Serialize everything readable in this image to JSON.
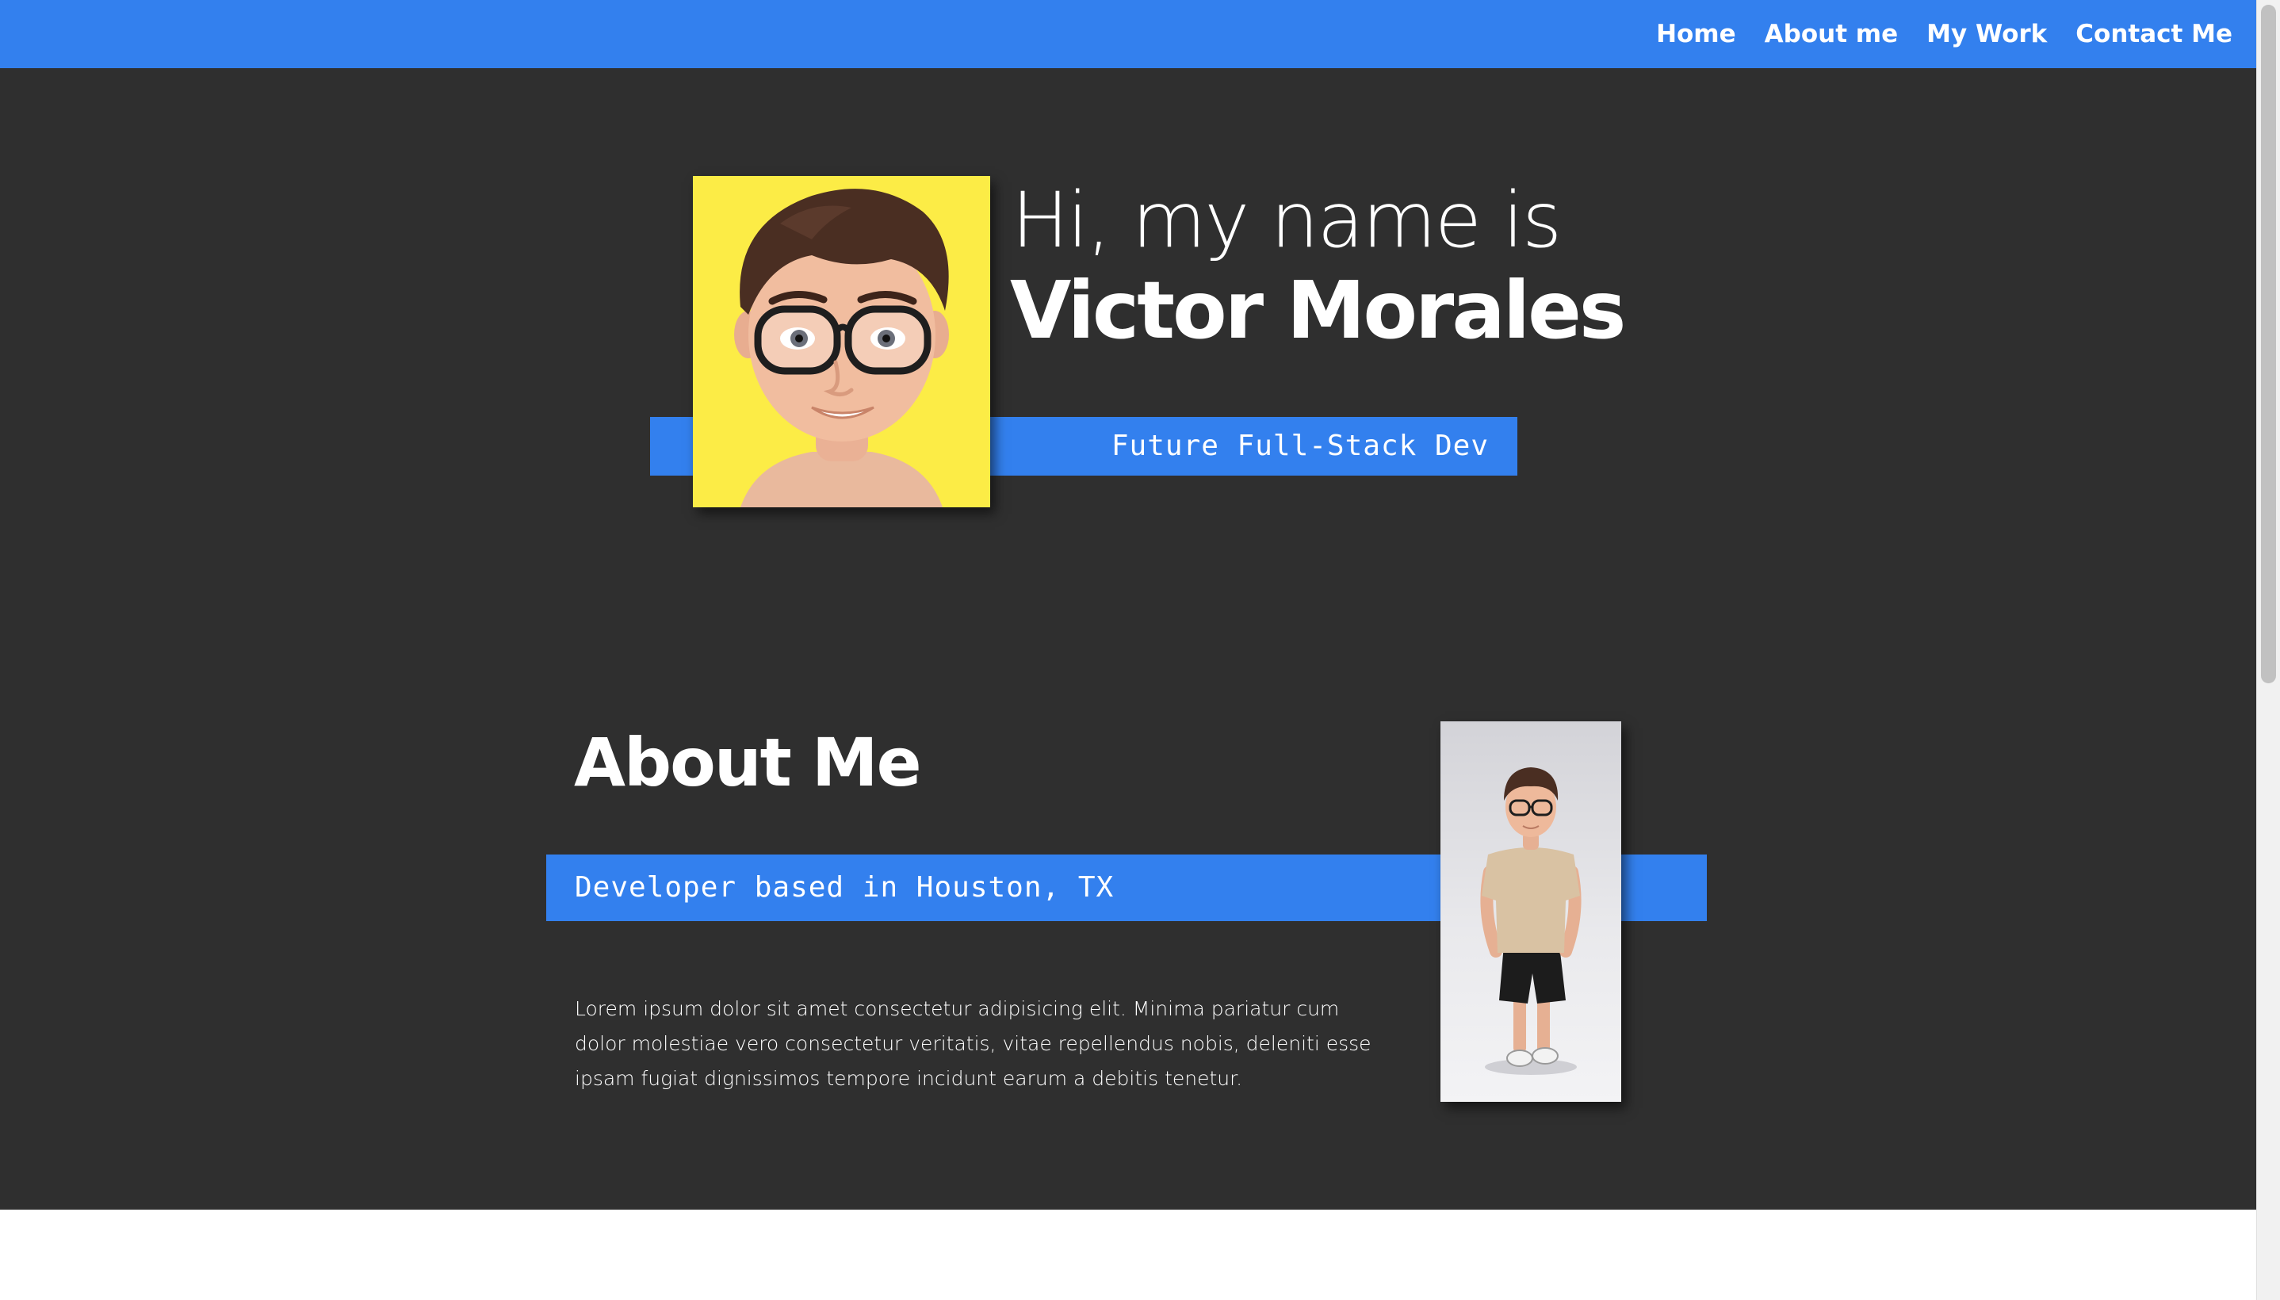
{
  "nav": {
    "links": [
      {
        "label": "Home"
      },
      {
        "label": "About me"
      },
      {
        "label": "My Work"
      },
      {
        "label": "Contact Me"
      }
    ]
  },
  "hero": {
    "greeting": "Hi, my name is",
    "name": "Victor Morales",
    "subtitle": "Future Full-Stack Dev"
  },
  "about": {
    "title": "About Me",
    "subtitle": "Developer based in Houston, TX",
    "body": "Lorem ipsum dolor sit amet consectetur adipisicing elit. Minima pariatur cum dolor molestiae vero consectetur veritatis, vitae repellendus nobis, deleniti esse ipsam fugiat dignissimos tempore incidunt earum a debitis tenetur."
  },
  "colors": {
    "accent": "#3380ee",
    "background_dark": "#2f2f2f",
    "portrait_background": "#fcec46"
  }
}
